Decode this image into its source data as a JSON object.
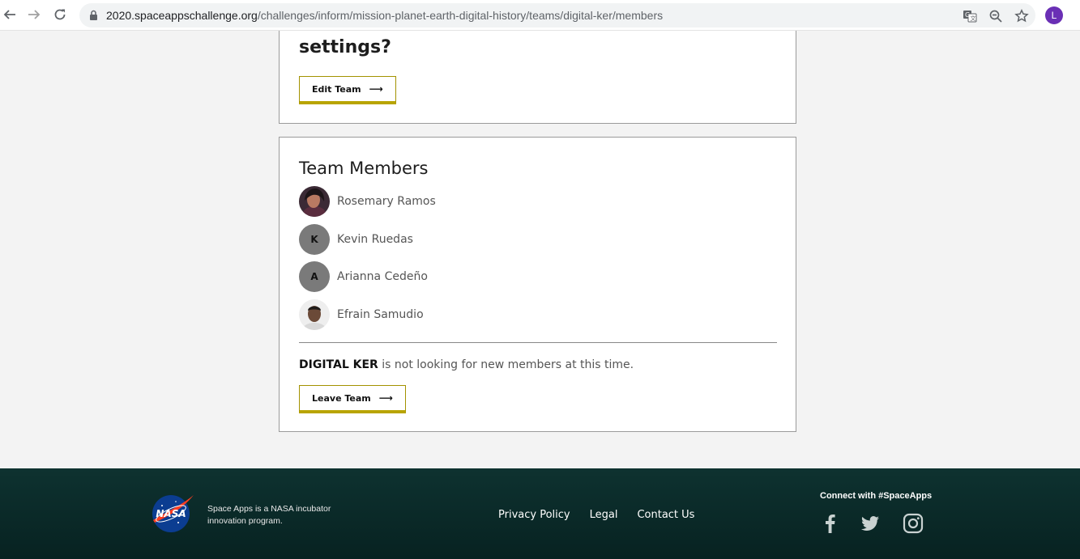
{
  "browser": {
    "url_host": "2020.spaceappschallenge.org",
    "url_path": "/challenges/inform/mission-planet-earth-digital-history/teams/digital-ker/members",
    "profile_initial": "L",
    "icons": [
      "back-icon",
      "forward-icon",
      "reload-icon",
      "lock-icon",
      "translate-icon",
      "zoom-icon",
      "star-icon"
    ]
  },
  "settings_card": {
    "heading": "settings?",
    "edit_button": "Edit Team",
    "arrow": "⟶"
  },
  "members_card": {
    "title": "Team Members",
    "members": [
      {
        "name": "Rosemary Ramos",
        "initial": ""
      },
      {
        "name": "Kevin Ruedas",
        "initial": "K"
      },
      {
        "name": "Arianna Cedeño",
        "initial": "A"
      },
      {
        "name": "Efrain Samudio",
        "initial": ""
      }
    ],
    "team_name": "DIGITAL KER",
    "status_suffix": " is not looking for new members at this time.",
    "leave_button": "Leave Team",
    "arrow": "⟶"
  },
  "footer": {
    "logo_text": "NASA",
    "tagline": "Space Apps is a NASA incubator innovation program.",
    "links": [
      "Privacy Policy",
      "Legal",
      "Contact Us"
    ],
    "connect_label": "Connect with #SpaceApps",
    "social_icons": [
      "facebook-icon",
      "twitter-icon",
      "instagram-icon"
    ],
    "colors": {
      "background": "#0b2a28",
      "button_accent": "#b8a400"
    }
  }
}
